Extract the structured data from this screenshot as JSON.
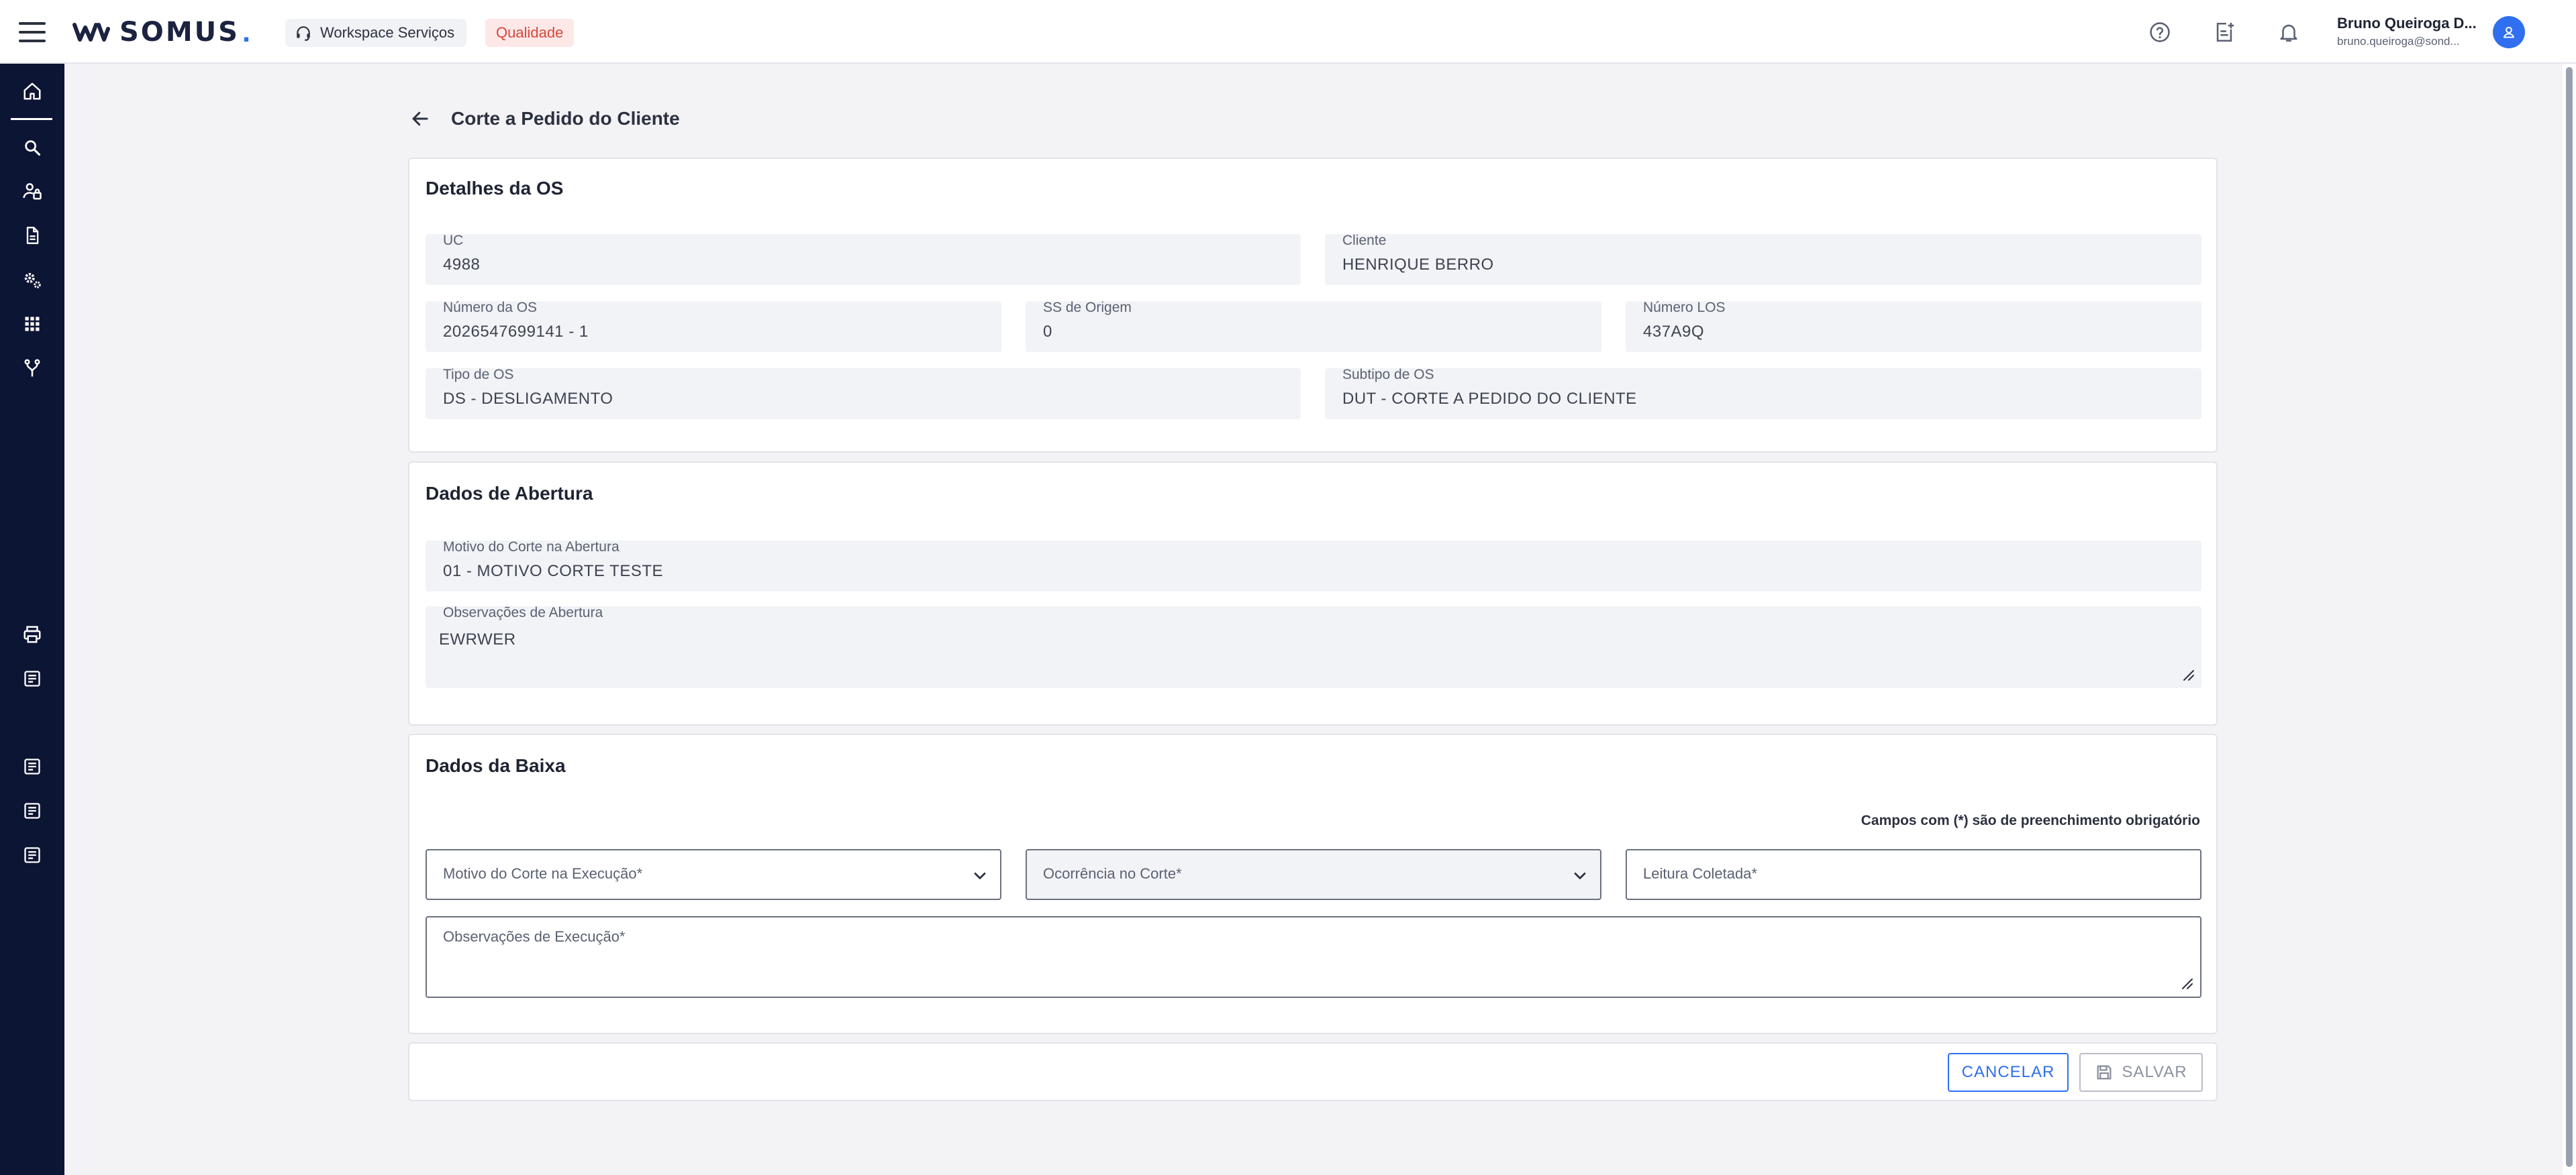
{
  "header": {
    "logo_text": "SOMUS",
    "logo_dot": ".",
    "workspace_label": "Workspace Serviços",
    "environment_badge": "Qualidade",
    "user_name": "Bruno Queiroga D...",
    "user_email": "bruno.queiroga@sond...",
    "icons": [
      "help-circle-icon",
      "add-note-icon",
      "bell-icon",
      "user-avatar-icon"
    ]
  },
  "sidebar": {
    "items": [
      "home-icon",
      "search-icon",
      "users-icon",
      "document-icon",
      "settings-icon",
      "apps-grid-icon",
      "branch-icon",
      "printer-icon",
      "notes-icon",
      "notes-icon",
      "notes-icon",
      "notes-icon"
    ],
    "active": "home-icon"
  },
  "page": {
    "title": "Corte a Pedido do Cliente"
  },
  "detalhes": {
    "title": "Detalhes da OS",
    "uc_label": "UC",
    "uc_value": "4988",
    "cliente_label": "Cliente",
    "cliente_value": "HENRIQUE BERRO",
    "numero_os_label": "Número da OS",
    "numero_os_value": "2026547699141 - 1",
    "ss_origem_label": "SS de Origem",
    "ss_origem_value": "0",
    "numero_los_label": "Número LOS",
    "numero_los_value": "437A9Q",
    "tipo_os_label": "Tipo de OS",
    "tipo_os_value": "DS - DESLIGAMENTO",
    "subtipo_os_label": "Subtipo de OS",
    "subtipo_os_value": "DUT - CORTE A PEDIDO DO CLIENTE"
  },
  "abertura": {
    "title": "Dados de Abertura",
    "motivo_label": "Motivo do Corte na Abertura",
    "motivo_value": "01 - MOTIVO CORTE TESTE",
    "obs_label": "Observações de Abertura",
    "obs_value": "EWRWER"
  },
  "baixa": {
    "title": "Dados da Baixa",
    "required_note": "Campos com (*) são de preenchimento obrigatório",
    "motivo_placeholder": "Motivo do Corte na Execução*",
    "ocorrencia_placeholder": "Ocorrência no Corte*",
    "leitura_placeholder": "Leitura Coletada*",
    "obs_placeholder": "Observações de Execução*"
  },
  "actions": {
    "cancel_label": "CANCELAR",
    "save_label": "SALVAR"
  },
  "colors": {
    "sidebar_bg": "#0c1533",
    "accent": "#2f6ff0",
    "badge_text": "#d9463b",
    "badge_bg": "#fde8e7",
    "page_bg": "#f3f3f6"
  }
}
